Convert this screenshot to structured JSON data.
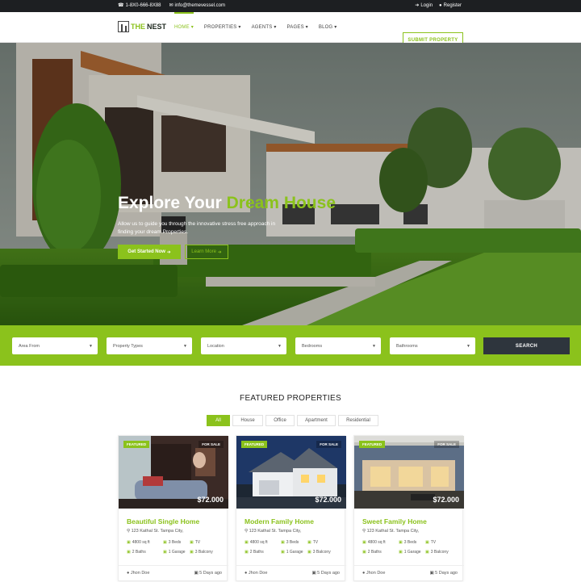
{
  "topbar": {
    "phone": "1-8X0-666-8X88",
    "email": "info@themevessel.com",
    "login": "Login",
    "register": "Register"
  },
  "logo": {
    "the": "THE",
    "nest": "NEST"
  },
  "nav": {
    "items": [
      "HOME",
      "PROPERTIES",
      "AGENTS",
      "PAGES",
      "BLOG"
    ],
    "active": "HOME",
    "submit_label": "SUBMIT PROPERTY"
  },
  "hero": {
    "title_prefix": "Explore Your",
    "title_highlight": "Dream House",
    "subtitle": "Allow us to guide you through the innovative stress free approach in finding your dream Properties.",
    "get_started": "Get Started Now",
    "learn_more": "Learn More"
  },
  "search": {
    "fields": [
      "Area From",
      "Property Types",
      "Location",
      "Bedrooms",
      "Bathrooms"
    ],
    "button": "SEARCH"
  },
  "featured": {
    "title": "FEATURED PROPERTIES",
    "filters": [
      "All",
      "House",
      "Office",
      "Apartment",
      "Residential"
    ],
    "active_filter": "All",
    "cards": [
      {
        "badge": "FEATURED",
        "status": "FOR SALE",
        "price": "$72.000",
        "title": "Beautiful Single Home",
        "address": "123 Kathal St. Tampa City,",
        "area": "4800 sq ft",
        "beds": "3 Beds",
        "tv": "TV",
        "baths": "2 Baths",
        "garage": "1 Garage",
        "balcony": "3 Balcony",
        "agent": "Jhon Doe",
        "ago": "5 Days ago"
      },
      {
        "badge": "FEATURED",
        "status": "FOR SALE",
        "price": "$72.000",
        "title": "Modern Family Home",
        "address": "123 Kathal St. Tampa City,",
        "area": "4800 sq ft",
        "beds": "3 Beds",
        "tv": "TV",
        "baths": "2 Baths",
        "garage": "1 Garage",
        "balcony": "3 Balcony",
        "agent": "Jhon Doe",
        "ago": "5 Days ago"
      },
      {
        "badge": "FEATURED",
        "status": "FOR SALE",
        "price": "$72.000",
        "title": "Sweet Family Home",
        "address": "123 Kathal St. Tampa City,",
        "area": "4800 sq ft",
        "beds": "3 Beds",
        "tv": "TV",
        "baths": "2 Baths",
        "garage": "1 Garage",
        "balcony": "3 Balcony",
        "agent": "Jhon Doe",
        "ago": "5 Days ago"
      }
    ]
  },
  "colors": {
    "accent": "#8bc21c",
    "dark": "#1d1f22",
    "button_dark": "#2e353d"
  }
}
